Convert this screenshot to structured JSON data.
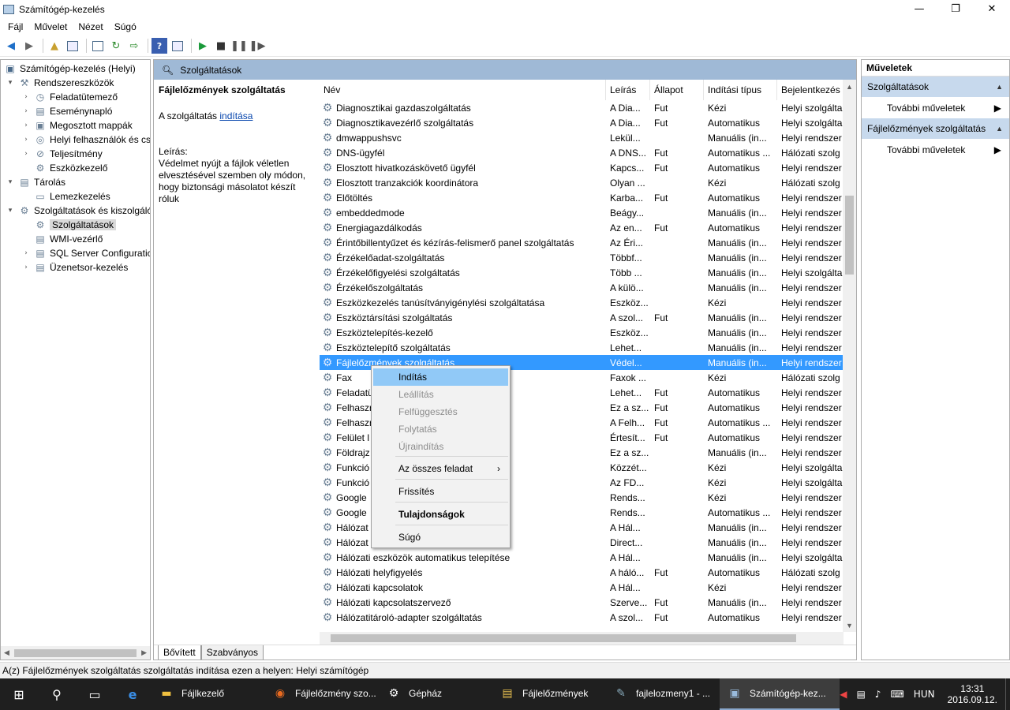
{
  "window": {
    "title": "Számítógép-kezelés",
    "min": "—",
    "max": "❐",
    "close": "✕"
  },
  "menu": [
    "Fájl",
    "Művelet",
    "Nézet",
    "Súgó"
  ],
  "tree": {
    "root": "Számítógép-kezelés (Helyi)",
    "nodes": [
      {
        "label": "Rendszereszközök",
        "level": 1,
        "exp": "▾"
      },
      {
        "label": "Feladatütemező",
        "level": 2,
        "exp": "›"
      },
      {
        "label": "Eseménynapló",
        "level": 2,
        "exp": "›"
      },
      {
        "label": "Megosztott mappák",
        "level": 2,
        "exp": "›"
      },
      {
        "label": "Helyi felhasználók és cs",
        "level": 2,
        "exp": "›"
      },
      {
        "label": "Teljesítmény",
        "level": 2,
        "exp": "›"
      },
      {
        "label": "Eszközkezelő",
        "level": 2,
        "exp": ""
      },
      {
        "label": "Tárolás",
        "level": 1,
        "exp": "▾"
      },
      {
        "label": "Lemezkezelés",
        "level": 2,
        "exp": ""
      },
      {
        "label": "Szolgáltatások és kiszolgáló",
        "level": 1,
        "exp": "▾"
      },
      {
        "label": "Szolgáltatások",
        "level": 2,
        "exp": ""
      },
      {
        "label": "WMI-vezérlő",
        "level": 2,
        "exp": ""
      },
      {
        "label": "SQL Server Configuratic",
        "level": 2,
        "exp": "›"
      },
      {
        "label": "Üzenetsor-kezelés",
        "level": 2,
        "exp": "›"
      }
    ]
  },
  "center": {
    "header": "Szolgáltatások",
    "desc_title": "Fájlelőzmények szolgáltatás",
    "desc_start_prefix": "A szolgáltatás ",
    "desc_start_link": "indítása",
    "desc_label": "Leírás:",
    "desc_text": "Védelmet nyújt a fájlok véletlen elvesztésével szemben oly módon, hogy biztonsági másolatot készít róluk"
  },
  "columns": [
    "Név",
    "Leírás",
    "Állapot",
    "Indítási típus",
    "Bejelentkezés"
  ],
  "rows": [
    [
      "Diagnosztikai gazdaszolgáltatás",
      "A Dia...",
      "Fut",
      "Kézi",
      "Helyi szolgálta"
    ],
    [
      "Diagnosztikavezérlő szolgáltatás",
      "A Dia...",
      "Fut",
      "Automatikus",
      "Helyi szolgálta"
    ],
    [
      "dmwappushsvc",
      "Lekül...",
      "",
      "Manuális (in...",
      "Helyi rendszer"
    ],
    [
      "DNS-ügyfél",
      "A DNS...",
      "Fut",
      "Automatikus ...",
      "Hálózati szolg"
    ],
    [
      "Elosztott hivatkozáskövető ügyfél",
      "Kapcs...",
      "Fut",
      "Automatikus",
      "Helyi rendszer"
    ],
    [
      "Elosztott tranzakciók koordinátora",
      "Olyan ...",
      "",
      "Kézi",
      "Hálózati szolg"
    ],
    [
      "Előtöltés",
      "Karba...",
      "Fut",
      "Automatikus",
      "Helyi rendszer"
    ],
    [
      "embeddedmode",
      "Beágy...",
      "",
      "Manuális (in...",
      "Helyi rendszer"
    ],
    [
      "Energiagazdálkodás",
      "Az en...",
      "Fut",
      "Automatikus",
      "Helyi rendszer"
    ],
    [
      "Érintőbillentyűzet és kézírás-felismerő panel szolgáltatás",
      "Az Éri...",
      "",
      "Manuális (in...",
      "Helyi rendszer"
    ],
    [
      "Érzékelőadat-szolgáltatás",
      "Többf...",
      "",
      "Manuális (in...",
      "Helyi rendszer"
    ],
    [
      "Érzékelőfigyelési szolgáltatás",
      "Több ...",
      "",
      "Manuális (in...",
      "Helyi szolgálta"
    ],
    [
      "Érzékelőszolgáltatás",
      "A külö...",
      "",
      "Manuális (in...",
      "Helyi rendszer"
    ],
    [
      "Eszközkezelés tanúsítványigénylési szolgáltatása",
      "Eszköz...",
      "",
      "Kézi",
      "Helyi rendszer"
    ],
    [
      "Eszköztársítási szolgáltatás",
      "A szol...",
      "Fut",
      "Manuális (in...",
      "Helyi rendszer"
    ],
    [
      "Eszköztelepítés-kezelő",
      "Eszköz...",
      "",
      "Manuális (in...",
      "Helyi rendszer"
    ],
    [
      "Eszköztelepítő szolgáltatás",
      "Lehet...",
      "",
      "Manuális (in...",
      "Helyi rendszer"
    ],
    [
      "Fájlelőzmények szolgáltatás",
      "Védel...",
      "",
      "Manuális (in...",
      "Helyi rendszer"
    ],
    [
      "Fax",
      "Faxok ...",
      "",
      "Kézi",
      "Hálózati szolg"
    ],
    [
      "Feladatü",
      "Lehet...",
      "Fut",
      "Automatikus",
      "Helyi rendszer"
    ],
    [
      "Felhaszn",
      "Ez a sz...",
      "Fut",
      "Automatikus",
      "Helyi rendszer"
    ],
    [
      "Felhaszn",
      "A Felh...",
      "Fut",
      "Automatikus ...",
      "Helyi rendszer"
    ],
    [
      "Felület l",
      "Értesít...",
      "Fut",
      "Automatikus",
      "Helyi rendszer"
    ],
    [
      "Földrajz",
      "Ez a sz...",
      "",
      "Manuális (in...",
      "Helyi rendszer"
    ],
    [
      "Funkció",
      "Közzét...",
      "",
      "Kézi",
      "Helyi szolgálta"
    ],
    [
      "Funkció",
      "Az FD...",
      "",
      "Kézi",
      "Helyi szolgálta"
    ],
    [
      "Google",
      "Rends...",
      "",
      "Kézi",
      "Helyi rendszer"
    ],
    [
      "Google",
      "Rends...",
      "",
      "Automatikus ...",
      "Helyi rendszer"
    ],
    [
      "Hálózat",
      "A Hál...",
      "",
      "Manuális (in...",
      "Helyi rendszer"
    ],
    [
      "Hálózat",
      "Direct...",
      "",
      "Manuális (in...",
      "Helyi rendszer"
    ],
    [
      "Hálózati eszközök automatikus telepítése",
      "A Hál...",
      "",
      "Manuális (in...",
      "Helyi szolgálta"
    ],
    [
      "Hálózati helyfigyelés",
      "A háló...",
      "Fut",
      "Automatikus",
      "Hálózati szolg"
    ],
    [
      "Hálózati kapcsolatok",
      "A Hál...",
      "",
      "Kézi",
      "Helyi rendszer"
    ],
    [
      "Hálózati kapcsolatszervező",
      "Szerve...",
      "Fut",
      "Manuális (in...",
      "Helyi rendszer"
    ],
    [
      "Hálózatitároló-adapter szolgáltatás",
      "A szol...",
      "Fut",
      "Automatikus",
      "Helyi rendszer"
    ]
  ],
  "selected_row": 17,
  "tabs": [
    "Bővített",
    "Szabványos"
  ],
  "actions": {
    "title": "Műveletek",
    "sections": [
      {
        "label": "Szolgáltatások",
        "item": "További műveletek"
      },
      {
        "label": "Fájlelőzmények szolgáltatás",
        "item": "További műveletek"
      }
    ]
  },
  "context_menu": [
    {
      "label": "Indítás",
      "state": "highlight"
    },
    {
      "label": "Leállítás",
      "state": "disabled"
    },
    {
      "label": "Felfüggesztés",
      "state": "disabled"
    },
    {
      "label": "Folytatás",
      "state": "disabled"
    },
    {
      "label": "Újraindítás",
      "state": "disabled"
    },
    {
      "label": "Az összes feladat",
      "state": "submenu"
    },
    {
      "label": "Frissítés",
      "state": "normal"
    },
    {
      "label": "Tulajdonságok",
      "state": "bold"
    },
    {
      "label": "Súgó",
      "state": "normal"
    }
  ],
  "status": "A(z) Fájlelőzmények szolgáltatás szolgáltatás indítása ezen a helyen: Helyi számítógép",
  "taskbar": {
    "tasks": [
      "Fájlkezelő",
      "Fájlelőzmény szo...",
      "Gépház",
      "Fájlelőzmények",
      "fajlelozmeny1 - ...",
      "Számítógép-kez..."
    ],
    "lang": "HUN",
    "time": "13:31",
    "date": "2016.09.12."
  }
}
